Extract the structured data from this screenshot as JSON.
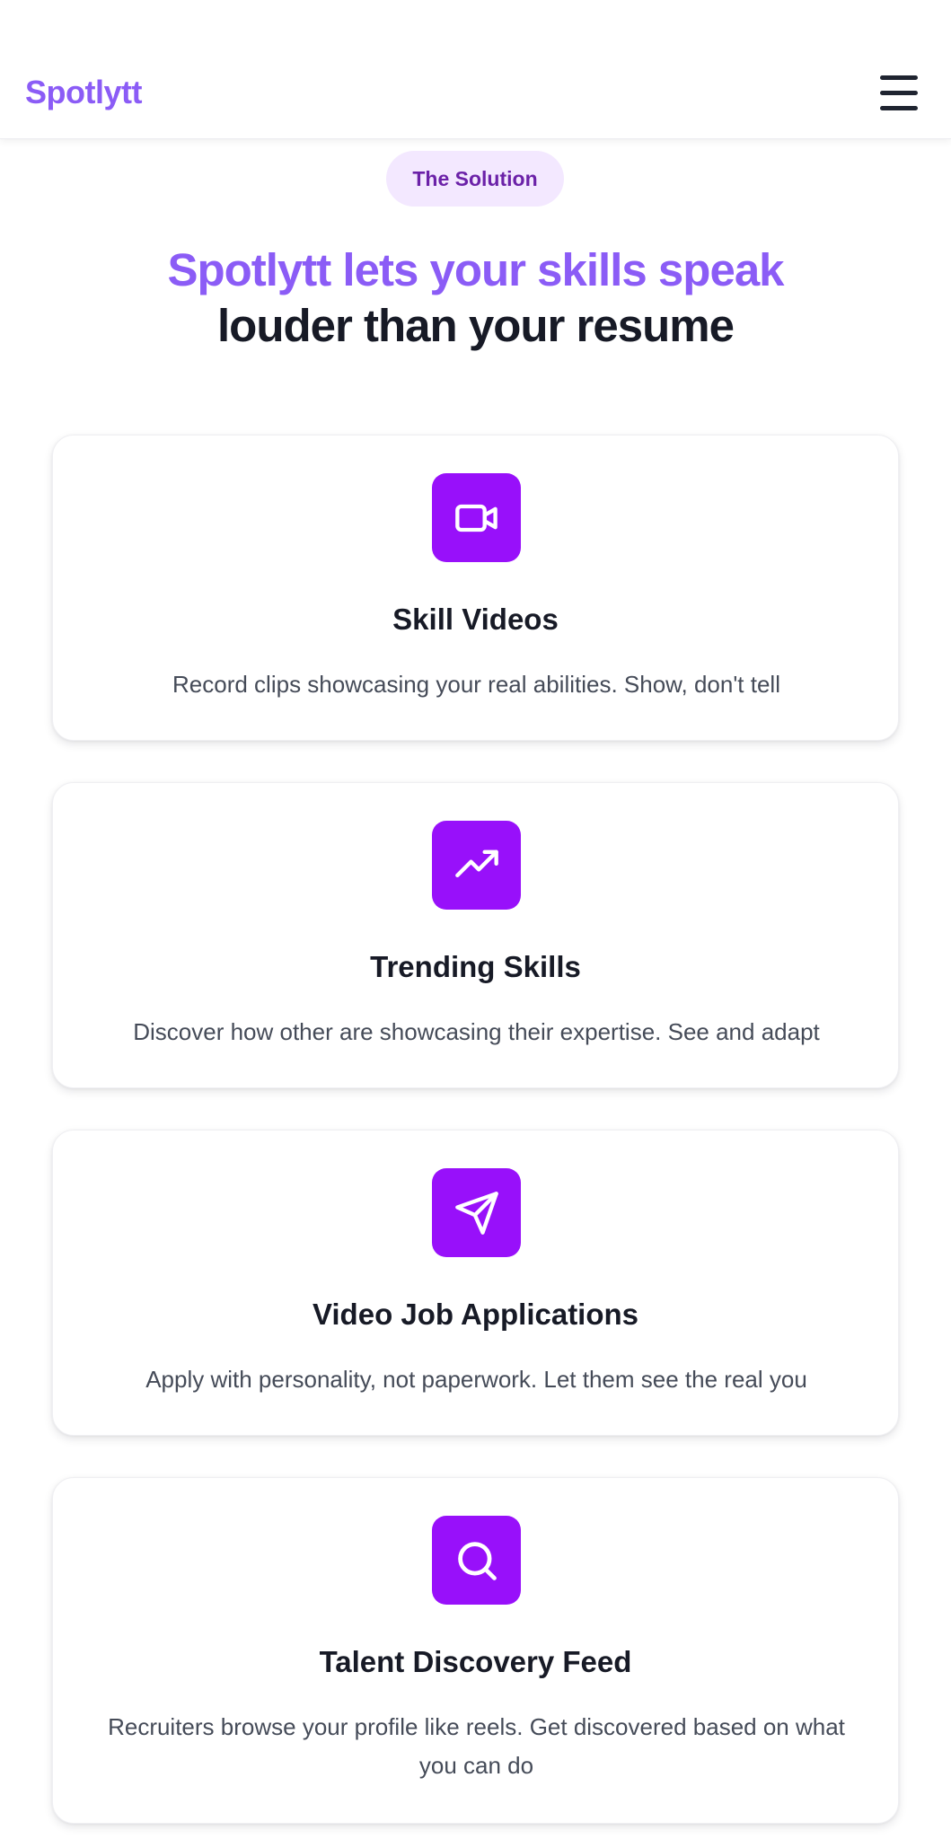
{
  "header": {
    "brand": "Spotlytt",
    "menu_icon": "hamburger-menu-icon"
  },
  "hero": {
    "badge": "The Solution",
    "headline_accent": "Spotlytt lets your skills speak",
    "headline_dark": "louder than your resume"
  },
  "features": [
    {
      "icon": "video-camera-icon",
      "title": "Skill Videos",
      "description": "Record clips showcasing your real abilities. Show, don't tell"
    },
    {
      "icon": "trending-up-icon",
      "title": "Trending Skills",
      "description": "Discover how other are showcasing their expertise. See and adapt"
    },
    {
      "icon": "send-icon",
      "title": "Video Job Applications",
      "description": "Apply with personality, not paperwork. Let them see the real you"
    },
    {
      "icon": "search-icon",
      "title": "Talent Discovery Feed",
      "description": "Recruiters browse your profile like reels. Get discovered based on what you can do"
    }
  ],
  "colors": {
    "brand": "#8b5cf6",
    "icon_tile": "#9810fa",
    "badge_bg": "#f3e8ff",
    "badge_text": "#6b21a8",
    "heading_dark": "#171a26",
    "body_text": "#454b58"
  }
}
